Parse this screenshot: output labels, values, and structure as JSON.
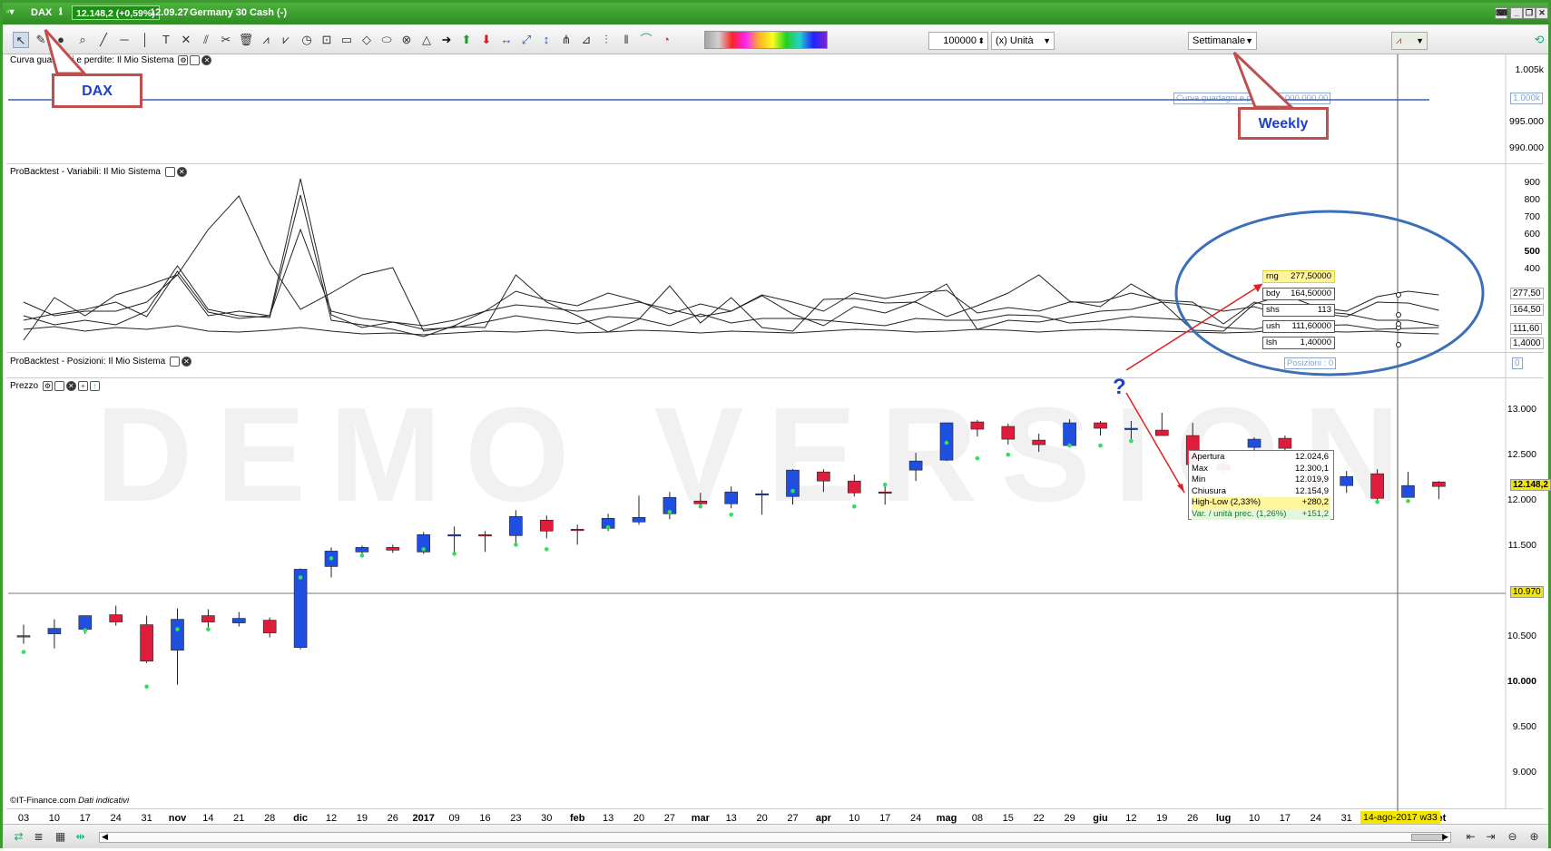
{
  "titlebar": {
    "symbol": "DAX",
    "price_badge": "12.148,2 (+0,59%)",
    "time": "12.09.27",
    "instrument": "Germany 30 Cash (-)"
  },
  "toolbar": {
    "quantity": "100000",
    "unit": "(x) Unità",
    "period": "Settimanale"
  },
  "annotations": {
    "dax": "DAX",
    "weekly": "Weekly",
    "question": "?"
  },
  "panels": {
    "equity": {
      "title": "Curva guadagni e perdite: Il Mio Sistema",
      "line_label": "Curva guadagni e perdite: 1.000.000,00",
      "current": "1.000k",
      "y_ticks": [
        "1.005k",
        "995.000",
        "990.000"
      ]
    },
    "variables": {
      "title": "ProBacktest - Variabili: Il Mio Sistema",
      "y_ticks": [
        "900",
        "800",
        "700",
        "600",
        "500",
        "400",
        "300"
      ],
      "markers": [
        "277,50",
        "164,50",
        "113",
        "111,60",
        "1,4000"
      ],
      "values": [
        {
          "name": "rng",
          "value": "277,50000"
        },
        {
          "name": "bdy",
          "value": "164,50000"
        },
        {
          "name": "shs",
          "value": "113"
        },
        {
          "name": "ush",
          "value": "111,60000"
        },
        {
          "name": "lsh",
          "value": "1,40000"
        }
      ]
    },
    "positions": {
      "title": "ProBacktest - Posizioni: Il Mio Sistema",
      "label": "Posizioni : 0",
      "current": "0"
    },
    "price": {
      "title": "Prezzo",
      "y_ticks": [
        "13.000",
        "12.500",
        "12.000",
        "11.500",
        "11.000",
        "10.500",
        "10.000",
        "9.500",
        "9.000"
      ],
      "last_price": "12.148,2",
      "crosshair_price": "10.970",
      "watermark": "DEMO VERSION",
      "source": "©IT-Finance.com",
      "source_note": "Dati indicativi"
    }
  },
  "tooltip": {
    "rows": [
      {
        "label": "Apertura",
        "value": "12.024,6"
      },
      {
        "label": "Max",
        "value": "12.300,1"
      },
      {
        "label": "Min",
        "value": "12.019,9"
      },
      {
        "label": "Chiusura",
        "value": "12.154,9"
      },
      {
        "label": "High-Low (2,33%)",
        "value": "+280,2"
      },
      {
        "label": "Var. / unità prec. (1,26%)",
        "value": "+151,2"
      }
    ]
  },
  "x_axis": {
    "labels": [
      "03",
      "10",
      "17",
      "24",
      "31",
      "nov",
      "14",
      "21",
      "28",
      "dic",
      "12",
      "19",
      "26",
      "2017",
      "09",
      "16",
      "23",
      "30",
      "feb",
      "13",
      "20",
      "27",
      "mar",
      "13",
      "20",
      "27",
      "apr",
      "10",
      "17",
      "24",
      "mag",
      "08",
      "15",
      "22",
      "29",
      "giu",
      "12",
      "19",
      "26",
      "lug",
      "10",
      "17",
      "24",
      "31",
      "",
      "28",
      "set"
    ],
    "crosshair_label": "14-ago-2017 w33"
  },
  "chart_data": {
    "type": "candlestick",
    "period": "weekly",
    "instrument": "DAX",
    "ylim": [
      8700,
      13300
    ],
    "candles": [
      {
        "o": 10500,
        "h": 10620,
        "l": 10410,
        "c": 10490,
        "dot": 10320
      },
      {
        "o": 10520,
        "h": 10680,
        "l": 10360,
        "c": 10580,
        "dot": null
      },
      {
        "o": 10570,
        "h": 10720,
        "l": 10520,
        "c": 10720,
        "dot": 10560
      },
      {
        "o": 10730,
        "h": 10830,
        "l": 10610,
        "c": 10650,
        "dot": null
      },
      {
        "o": 10620,
        "h": 10720,
        "l": 10200,
        "c": 10220,
        "dot": 9940
      },
      {
        "o": 10340,
        "h": 10800,
        "l": 9960,
        "c": 10680,
        "dot": 10570
      },
      {
        "o": 10720,
        "h": 10790,
        "l": 10580,
        "c": 10650,
        "dot": 10570
      },
      {
        "o": 10640,
        "h": 10760,
        "l": 10600,
        "c": 10690,
        "dot": null
      },
      {
        "o": 10670,
        "h": 10700,
        "l": 10480,
        "c": 10530,
        "dot": null
      },
      {
        "o": 10370,
        "h": 11240,
        "l": 10350,
        "c": 11230,
        "dot": 11140
      },
      {
        "o": 11260,
        "h": 11470,
        "l": 11140,
        "c": 11430,
        "dot": 11350
      },
      {
        "o": 11420,
        "h": 11490,
        "l": 11360,
        "c": 11470,
        "dot": 11380
      },
      {
        "o": 11470,
        "h": 11500,
        "l": 11410,
        "c": 11440,
        "dot": null
      },
      {
        "o": 11420,
        "h": 11640,
        "l": 11400,
        "c": 11610,
        "dot": 11450
      },
      {
        "o": 11600,
        "h": 11700,
        "l": 11400,
        "c": 11610,
        "dot": 11400
      },
      {
        "o": 11610,
        "h": 11650,
        "l": 11420,
        "c": 11600,
        "dot": null
      },
      {
        "o": 11600,
        "h": 11880,
        "l": 11480,
        "c": 11810,
        "dot": 11500
      },
      {
        "o": 11770,
        "h": 11820,
        "l": 11570,
        "c": 11650,
        "dot": 11450
      },
      {
        "o": 11670,
        "h": 11720,
        "l": 11500,
        "c": 11660,
        "dot": null
      },
      {
        "o": 11680,
        "h": 11840,
        "l": 11650,
        "c": 11790,
        "dot": 11690
      },
      {
        "o": 11750,
        "h": 12040,
        "l": 11720,
        "c": 11800,
        "dot": null
      },
      {
        "o": 11840,
        "h": 12080,
        "l": 11780,
        "c": 12020,
        "dot": 11860
      },
      {
        "o": 11980,
        "h": 12070,
        "l": 11910,
        "c": 11950,
        "dot": 11920
      },
      {
        "o": 11950,
        "h": 12140,
        "l": 11900,
        "c": 12080,
        "dot": 11830
      },
      {
        "o": 12060,
        "h": 12100,
        "l": 11830,
        "c": 12060,
        "dot": null
      },
      {
        "o": 12030,
        "h": 12330,
        "l": 11940,
        "c": 12320,
        "dot": 12090
      },
      {
        "o": 12300,
        "h": 12330,
        "l": 12080,
        "c": 12200,
        "dot": null
      },
      {
        "o": 12200,
        "h": 12270,
        "l": 12030,
        "c": 12070,
        "dot": 11920
      },
      {
        "o": 12080,
        "h": 12170,
        "l": 11940,
        "c": 12070,
        "dot": 12160
      },
      {
        "o": 12320,
        "h": 12510,
        "l": 12200,
        "c": 12420,
        "dot": null
      },
      {
        "o": 12430,
        "h": 12840,
        "l": 12420,
        "c": 12840,
        "dot": 12620
      },
      {
        "o": 12850,
        "h": 12870,
        "l": 12690,
        "c": 12770,
        "dot": 12450
      },
      {
        "o": 12800,
        "h": 12830,
        "l": 12600,
        "c": 12660,
        "dot": 12490
      },
      {
        "o": 12650,
        "h": 12720,
        "l": 12520,
        "c": 12600,
        "dot": null
      },
      {
        "o": 12590,
        "h": 12880,
        "l": 12570,
        "c": 12840,
        "dot": 12590
      },
      {
        "o": 12840,
        "h": 12860,
        "l": 12700,
        "c": 12780,
        "dot": 12590
      },
      {
        "o": 12770,
        "h": 12860,
        "l": 12650,
        "c": 12780,
        "dot": 12640
      },
      {
        "o": 12760,
        "h": 12950,
        "l": 12700,
        "c": 12700,
        "dot": null
      },
      {
        "o": 12700,
        "h": 12840,
        "l": 12370,
        "c": 12380,
        "dot": 12280
      },
      {
        "o": 12380,
        "h": 12500,
        "l": 12270,
        "c": 12320,
        "dot": null
      },
      {
        "o": 12570,
        "h": 12680,
        "l": 12460,
        "c": 12660,
        "dot": null
      },
      {
        "o": 12670,
        "h": 12700,
        "l": 12500,
        "c": 12560,
        "dot": null
      },
      {
        "o": 12180,
        "h": 12360,
        "l": 12050,
        "c": 12140,
        "dot": null
      },
      {
        "o": 12150,
        "h": 12310,
        "l": 12070,
        "c": 12250,
        "dot": null
      },
      {
        "o": 12280,
        "h": 12330,
        "l": 11970,
        "c": 12010,
        "dot": 11970
      },
      {
        "o": 12020,
        "h": 12300,
        "l": 12020,
        "c": 12150,
        "dot": 11980
      },
      {
        "o": 12190,
        "h": 12200,
        "l": 12000,
        "c": 12140,
        "dot": null
      }
    ]
  }
}
